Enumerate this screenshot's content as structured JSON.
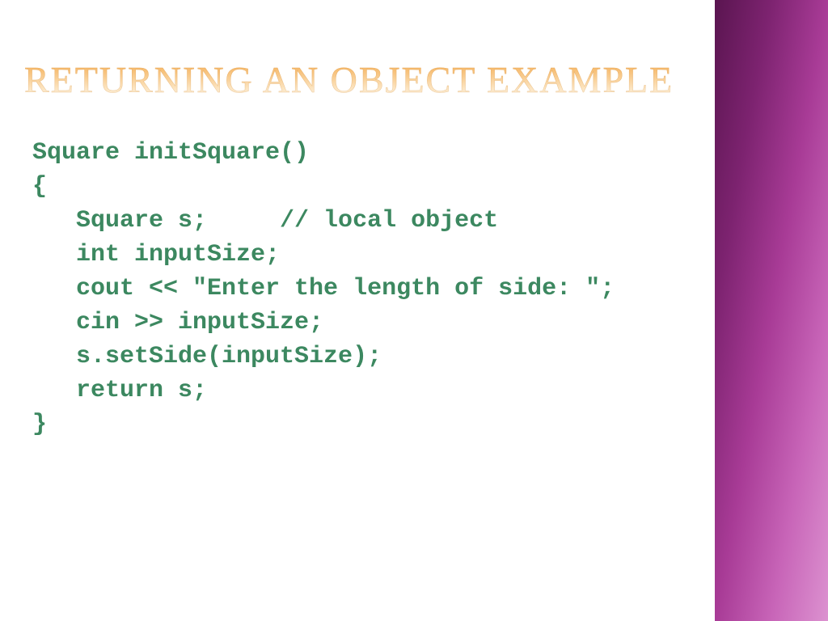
{
  "slide": {
    "title": "Returning an Object Example",
    "code": "Square initSquare()\n{\n   Square s;     // local object\n   int inputSize;\n   cout << \"Enter the length of side: \";\n   cin >> inputSize;\n   s.setSide(inputSize);\n   return s;\n}"
  }
}
